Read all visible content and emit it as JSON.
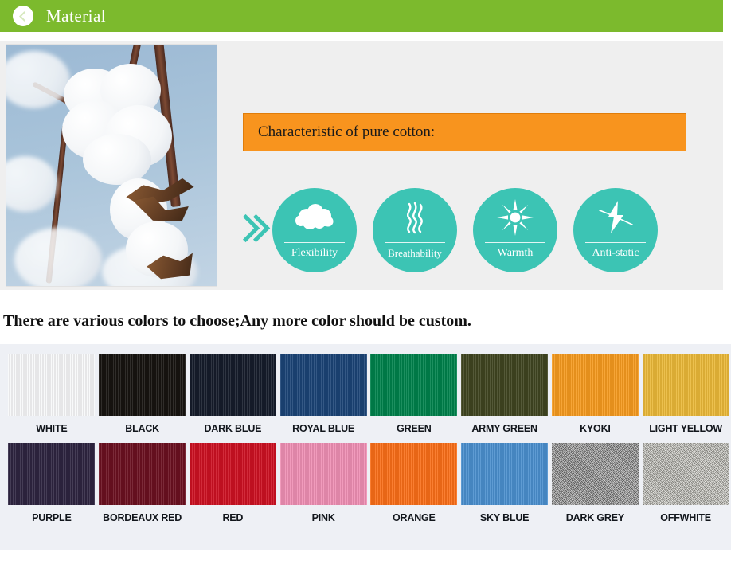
{
  "header": {
    "title": "Material",
    "icon": "circle-chevron-left-icon",
    "bar_color": "#7cba2d"
  },
  "material": {
    "photo_alt": "cotton-bolls-photo",
    "banner": {
      "text": "Characteristic of pure cotton:",
      "color": "#f8941e"
    },
    "arrow_icon": "double-chevron-right-icon",
    "circle_color": "#3cc4b4",
    "features": [
      {
        "label": "Flexibility",
        "icon": "cloud-icon"
      },
      {
        "label": "Breathability",
        "icon": "wavy-lines-icon"
      },
      {
        "label": "Warmth",
        "icon": "sun-icon"
      },
      {
        "label": "Anti-static",
        "icon": "lightning-bolt-icon"
      }
    ]
  },
  "colors_section": {
    "intro": "There are various colors to choose;Any more color should be custom.",
    "rows": [
      [
        {
          "label": "WHITE",
          "hex": "#f7f8f9",
          "texture": "rib"
        },
        {
          "label": "BLACK",
          "hex": "#171310",
          "texture": "rib"
        },
        {
          "label": "DARK BLUE",
          "hex": "#151c2b",
          "texture": "rib"
        },
        {
          "label": "ROYAL BLUE",
          "hex": "#1b4476",
          "texture": "rib"
        },
        {
          "label": "GREEN",
          "hex": "#00814b",
          "texture": "rib"
        },
        {
          "label": "ARMY GREEN",
          "hex": "#3f4520",
          "texture": "rib"
        },
        {
          "label": "KYOKI",
          "hex": "#f59a1e",
          "texture": "rib"
        },
        {
          "label": "LIGHT YELLOW",
          "hex": "#eab838",
          "texture": "rib"
        }
      ],
      [
        {
          "label": "PURPLE",
          "hex": "#2e2541",
          "texture": "rib"
        },
        {
          "label": "BORDEAUX RED",
          "hex": "#6b1020",
          "texture": "rib"
        },
        {
          "label": "RED",
          "hex": "#cc1122",
          "texture": "rib"
        },
        {
          "label": "PINK",
          "hex": "#ef8fb4",
          "texture": "rib"
        },
        {
          "label": "ORANGE",
          "hex": "#f96e18",
          "texture": "rib"
        },
        {
          "label": "SKY BLUE",
          "hex": "#4a8fce",
          "texture": "rib"
        },
        {
          "label": "DARK GREY",
          "hex": "#8d8d8d",
          "texture": "melange"
        },
        {
          "label": "OFFWHITE",
          "hex": "#c9c8bf",
          "texture": "melange"
        }
      ]
    ]
  }
}
